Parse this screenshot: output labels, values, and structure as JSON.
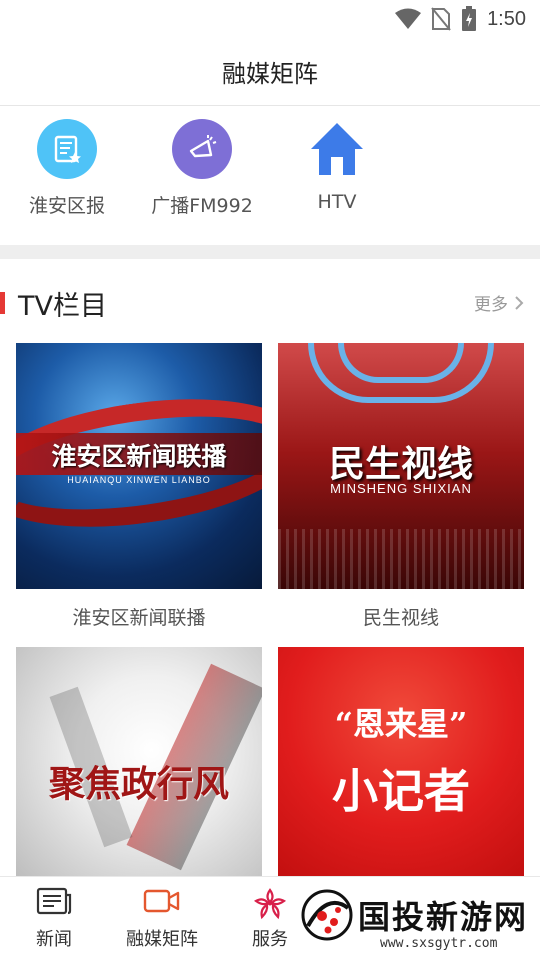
{
  "status_bar": {
    "time": "1:50"
  },
  "header": {
    "title": "融媒矩阵"
  },
  "quick_links": [
    {
      "label": "淮安区报",
      "icon": "newspaper-icon",
      "color": "#4fc3f7"
    },
    {
      "label": "广播FM992",
      "icon": "megaphone-icon",
      "color": "#7e6fd6"
    },
    {
      "label": "HTV",
      "icon": "home-icon",
      "color": "#3d7be8"
    }
  ],
  "section": {
    "title": "TV栏目",
    "more_label": "更多"
  },
  "cards": [
    {
      "caption": "淮安区新闻联播",
      "thumb_title": "淮安区新闻联播",
      "thumb_sub": "HUAIANQU XINWEN LIANBO"
    },
    {
      "caption": "民生视线",
      "thumb_title": "民生视线",
      "thumb_sub": "MINSHENG SHIXIAN"
    },
    {
      "caption": "",
      "thumb_title": "聚焦政行风"
    },
    {
      "caption": "",
      "thumb_quote": "“恩来星”",
      "thumb_title": "小记者"
    }
  ],
  "tabbar": {
    "items": [
      {
        "label": "新闻",
        "icon": "news-icon"
      },
      {
        "label": "融媒矩阵",
        "icon": "video-camera-icon",
        "active": true
      },
      {
        "label": "服务",
        "icon": "flower-icon"
      }
    ],
    "accent": "#e4572e"
  },
  "watermark": {
    "text": "国投新游网",
    "url": "www.sxsgytr.com"
  }
}
